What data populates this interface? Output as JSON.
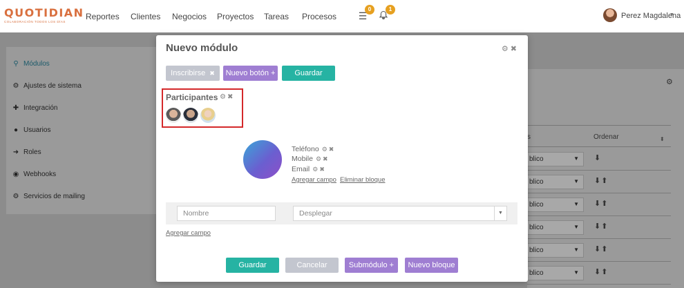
{
  "header": {
    "logo_word": "QUOTIDIAN",
    "logo_tag": "COLABORACIÓN TODOS LOS DÍAS",
    "nav": [
      "Reportes",
      "Clientes",
      "Negocios",
      "Proyectos",
      "Tareas",
      "Procesos"
    ],
    "tasks_badge": "0",
    "notifications_badge": "1",
    "user_name": "Perez Magdalena"
  },
  "sidebar": {
    "items": [
      {
        "label": "Módulos",
        "icon": "sitemap-icon"
      },
      {
        "label": "Ajustes de sistema",
        "icon": "gears-icon"
      },
      {
        "label": "Integración",
        "icon": "puzzle-icon"
      },
      {
        "label": "Usuarios",
        "icon": "user-icon"
      },
      {
        "label": "Roles",
        "icon": "arrow-right-icon"
      },
      {
        "label": "Webhooks",
        "icon": "globe-icon"
      },
      {
        "label": "Servicios de mailing",
        "icon": "gear-icon"
      }
    ]
  },
  "background_table": {
    "col_partial": "s",
    "col_order": "Ordenar",
    "select_value_partial": "blico"
  },
  "modal": {
    "title": "Nuevo módulo",
    "top_buttons": {
      "subscribe": "Inscribirse",
      "new_button": "Nuevo botón +",
      "save": "Guardar"
    },
    "participants_title": "Participantes",
    "fields": [
      "Teléfono",
      "Mobile",
      "Email"
    ],
    "add_field_inline": "Agregar campo",
    "delete_block": "Eliminar bloque",
    "name_placeholder": "Nombre",
    "dropdown_value": "Desplegar",
    "add_field": "Agregar campo",
    "footer_buttons": {
      "save": "Guardar",
      "cancel": "Cancelar",
      "submodule": "Submódulo +",
      "new_block": "Nuevo bloque +"
    }
  },
  "colors": {
    "teal": "#26b3a3",
    "purple": "#9f7ed2",
    "grey": "#c3c6cf",
    "highlight_red": "#d4282a"
  }
}
